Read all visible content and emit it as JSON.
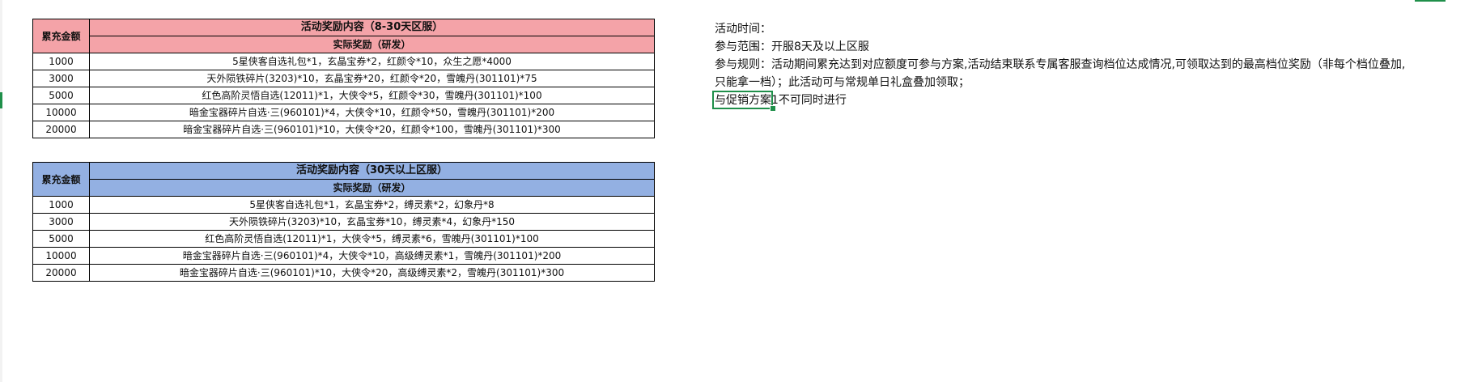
{
  "table1": {
    "header_amount": "累充金额",
    "title": "活动奖励内容（8-30天区服）",
    "subtitle": "实际奖励（研发）",
    "rows": [
      {
        "amount": "1000",
        "reward": "5星侠客自选礼包*1，玄晶宝券*2，红颜令*10，众生之愿*4000"
      },
      {
        "amount": "3000",
        "reward": "天外陨铁碎片(3203)*10，玄晶宝券*20，红颜令*20，雪魄丹(301101)*75"
      },
      {
        "amount": "5000",
        "reward": "红色高阶灵悟自选(12011)*1，大侠令*5，红颜令*30，雪魄丹(301101)*100"
      },
      {
        "amount": "10000",
        "reward": "暗金宝器碎片自选·三(960101)*4，大侠令*10，红颜令*50，雪魄丹(301101)*200"
      },
      {
        "amount": "20000",
        "reward": "暗金宝器碎片自选·三(960101)*10，大侠令*20，红颜令*100，雪魄丹(301101)*300"
      }
    ]
  },
  "table2": {
    "header_amount": "累充金额",
    "title": "活动奖励内容（30天以上区服）",
    "subtitle": "实际奖励（研发）",
    "rows": [
      {
        "amount": "1000",
        "reward": "5星侠客自选礼包*1，玄晶宝券*2，缚灵素*2，幻象丹*8"
      },
      {
        "amount": "3000",
        "reward": "天外陨铁碎片(3203)*10，玄晶宝券*10，缚灵素*4，幻象丹*150"
      },
      {
        "amount": "5000",
        "reward": "红色高阶灵悟自选(12011)*1，大侠令*5，缚灵素*6，雪魄丹(301101)*100"
      },
      {
        "amount": "10000",
        "reward": "暗金宝器碎片自选·三(960101)*4，大侠令*10，高级缚灵素*1，雪魄丹(301101)*200"
      },
      {
        "amount": "20000",
        "reward": "暗金宝器碎片自选·三(960101)*10，大侠令*20，高级缚灵素*2，雪魄丹(301101)*300"
      }
    ]
  },
  "notes": {
    "time": "活动时间：",
    "scope": "参与范围：开服8天及以上区服",
    "rules_line1": "参与规则：活动期间累充达到对应额度可参与方案,活动结束联系专属客服查询档位达成情况,可领取达到的最高档位奖励（非每个档位叠加,",
    "rules_line2": "只能拿一档）；此活动可与常规单日礼盒叠加领取；",
    "exclusion": "与促销方案1不可同时进行"
  },
  "colors": {
    "table1_header_bg": "#f4a3a8",
    "table2_header_bg": "#93b0e2",
    "selection": "#1f8f4a"
  }
}
